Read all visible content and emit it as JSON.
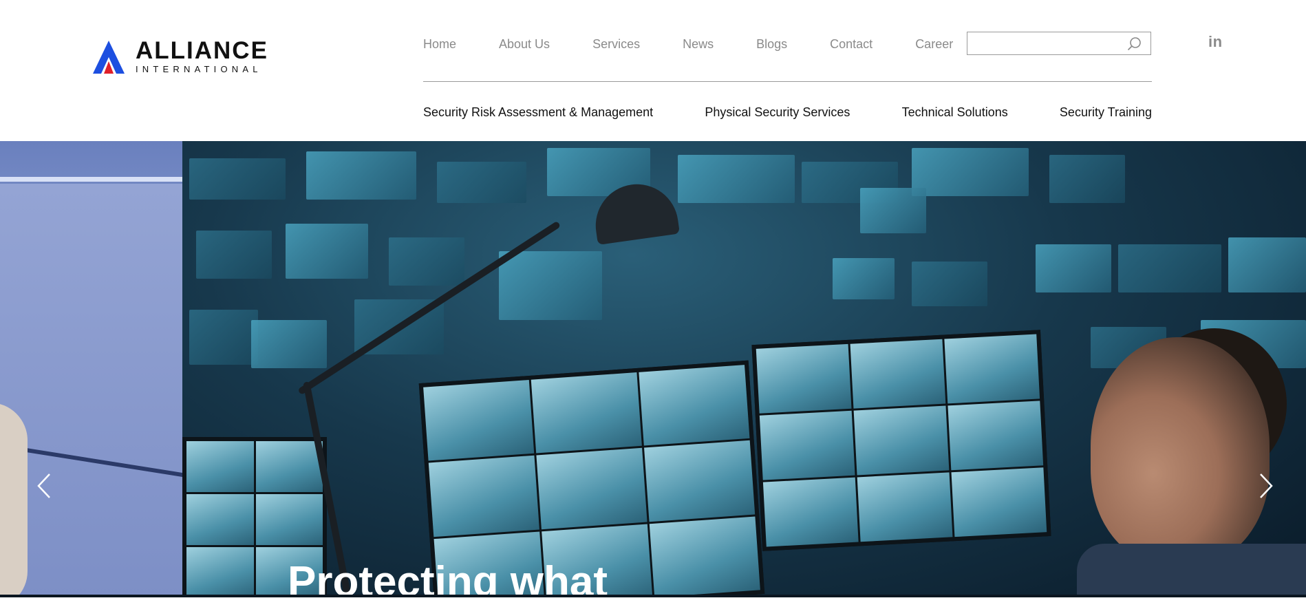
{
  "brand": {
    "name": "ALLIANCE",
    "subtitle": "INTERNATIONAL",
    "colors": {
      "blue": "#1d4fe0",
      "red": "#e0202a",
      "text": "#111111"
    }
  },
  "top_nav": {
    "items": [
      {
        "label": "Home"
      },
      {
        "label": "About Us"
      },
      {
        "label": "Services"
      },
      {
        "label": "News"
      },
      {
        "label": "Blogs"
      },
      {
        "label": "Contact"
      },
      {
        "label": "Career"
      }
    ],
    "color": "#8a8a8a"
  },
  "search": {
    "value": "",
    "placeholder": "",
    "icon": "search-icon"
  },
  "social": {
    "linkedin_label": "in",
    "icon": "linkedin-icon"
  },
  "sub_nav": {
    "items": [
      {
        "label": "Security Risk Assessment & Management"
      },
      {
        "label": "Physical Security Services"
      },
      {
        "label": "Technical Solutions"
      },
      {
        "label": "Security Training"
      }
    ]
  },
  "hero": {
    "heading": "Protecting what",
    "prev_icon": "chevron-left-icon",
    "next_icon": "chevron-right-icon"
  }
}
